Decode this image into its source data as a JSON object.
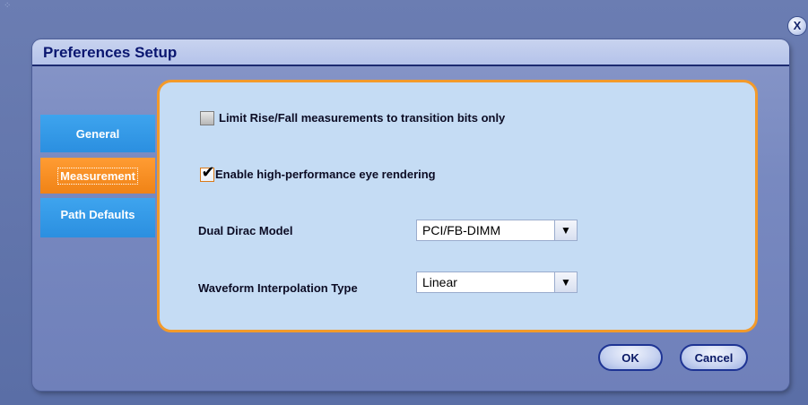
{
  "window": {
    "close_label": "X"
  },
  "dialog": {
    "title": "Preferences Setup"
  },
  "tabs": [
    {
      "label": "General",
      "active": false
    },
    {
      "label": "Measurement",
      "active": true
    },
    {
      "label": "Path Defaults",
      "active": false
    }
  ],
  "measurement": {
    "limit_rise_fall": {
      "label": "Limit Rise/Fall measurements to transition bits only",
      "checked": false
    },
    "high_perf_eye": {
      "label": "Enable high-performance eye rendering",
      "checked": true
    },
    "dual_dirac": {
      "label": "Dual Dirac Model",
      "value": "PCI/FB-DIMM"
    },
    "waveform_interp": {
      "label": "Waveform Interpolation Type",
      "value": "Linear"
    }
  },
  "buttons": {
    "ok": "OK",
    "cancel": "Cancel"
  },
  "icons": {
    "dropdown": "▼",
    "check": "✔"
  },
  "colors": {
    "active_tab": "#f08316",
    "inactive_tab": "#2b8fe0",
    "panel_border": "#f39a2a",
    "panel_bg": "#c5dcf4"
  }
}
